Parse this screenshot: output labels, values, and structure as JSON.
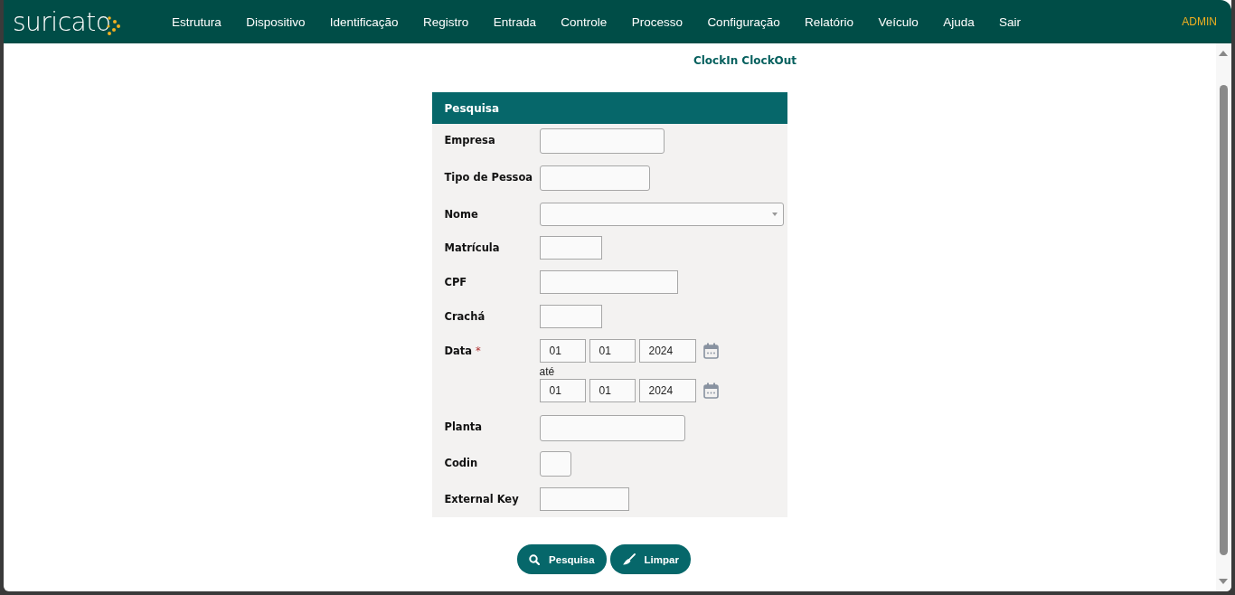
{
  "navbar": {
    "logo": "suricato",
    "menu": [
      "Estrutura",
      "Dispositivo",
      "Identificação",
      "Registro",
      "Entrada",
      "Controle",
      "Processo",
      "Configuração",
      "Relatório",
      "Veículo",
      "Ajuda",
      "Sair"
    ],
    "user": "ADMIN"
  },
  "page_title": "ClockIn ClockOut",
  "form": {
    "header": "Pesquisa",
    "fields": [
      {
        "label": "Empresa",
        "kind": "text"
      },
      {
        "label": "Tipo de Pessoa",
        "kind": "text"
      },
      {
        "label": "Nome",
        "kind": "select"
      },
      {
        "label": "Matrícula",
        "kind": "text"
      },
      {
        "label": "CPF",
        "kind": "text"
      },
      {
        "label": "Crachá",
        "kind": "text"
      },
      {
        "label": "Data",
        "kind": "date",
        "mark": "*",
        "from": {
          "day": "01",
          "month": "01",
          "year": "2024"
        },
        "separator": "até",
        "to": {
          "day": "01",
          "month": "01",
          "year": "2024"
        }
      },
      {
        "label": "Planta",
        "kind": "text"
      },
      {
        "label": "Codin",
        "kind": "text"
      },
      {
        "label": "External Key",
        "kind": "text"
      }
    ]
  },
  "buttons": [
    {
      "label": "Pesquisa",
      "kind": "search"
    },
    {
      "label": "Limpar",
      "kind": "clear"
    }
  ]
}
